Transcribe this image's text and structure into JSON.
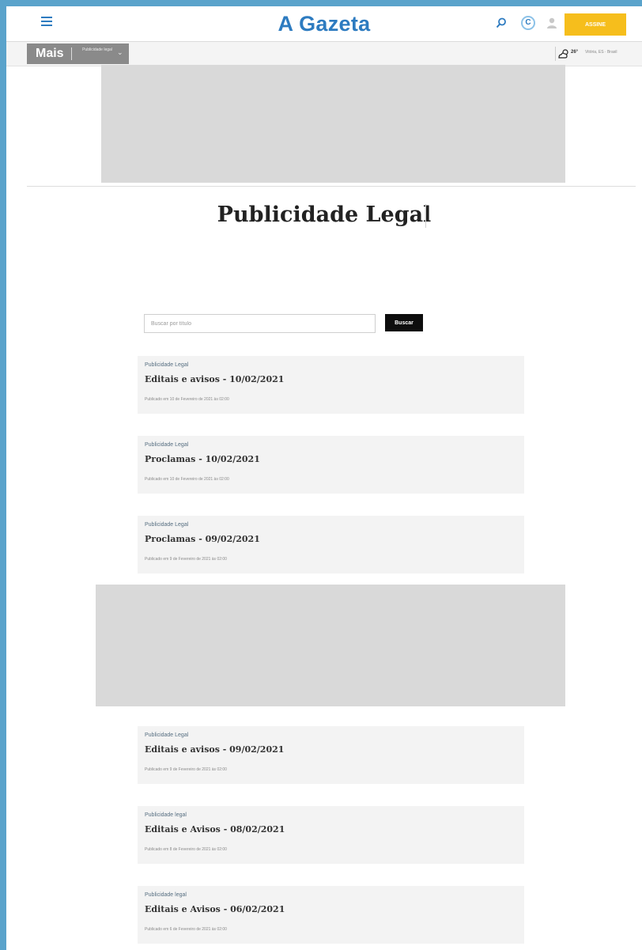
{
  "header": {
    "logo": "A Gazeta",
    "cta_label": "ASSINE",
    "c_icon_label": "C"
  },
  "subbar": {
    "mais_label": "Mais",
    "section_label": "Publicidade legal",
    "weather_temp": "26°",
    "weather_city": "Vitória, ES · Brasil"
  },
  "page": {
    "title": "Publicidade Legal"
  },
  "search": {
    "placeholder": "Buscar por título",
    "button_label": "Buscar"
  },
  "articles": [
    {
      "category": "Publicidade Legal",
      "title": "Editais e avisos - 10/02/2021",
      "meta": "Publicado em 10 de Fevereiro de 2021 às 02:00"
    },
    {
      "category": "Publicidade Legal",
      "title": "Proclamas - 10/02/2021",
      "meta": "Publicado em 10 de Fevereiro de 2021 às 02:00"
    },
    {
      "category": "Publicidade Legal",
      "title": "Proclamas - 09/02/2021",
      "meta": "Publicado em 9 de Fevereiro de 2021 às 02:00"
    },
    {
      "category": "Publicidade Legal",
      "title": "Editais e avisos - 09/02/2021",
      "meta": "Publicado em 9 de Fevereiro de 2021 às 02:00"
    },
    {
      "category": "Publicidade legal",
      "title": "Editais e Avisos - 08/02/2021",
      "meta": "Publicado em 8 de Fevereiro de 2021 às 02:00"
    },
    {
      "category": "Publicidade legal",
      "title": "Editais e Avisos - 06/02/2021",
      "meta": "Publicado em 6 de Fevereiro de 2021 às 02:00"
    }
  ],
  "colors": {
    "brand_blue": "#2d7bc0",
    "cta_yellow": "#f6be1c",
    "card_bg": "#f3f3f3",
    "ad_placeholder": "#d9d9d9"
  }
}
